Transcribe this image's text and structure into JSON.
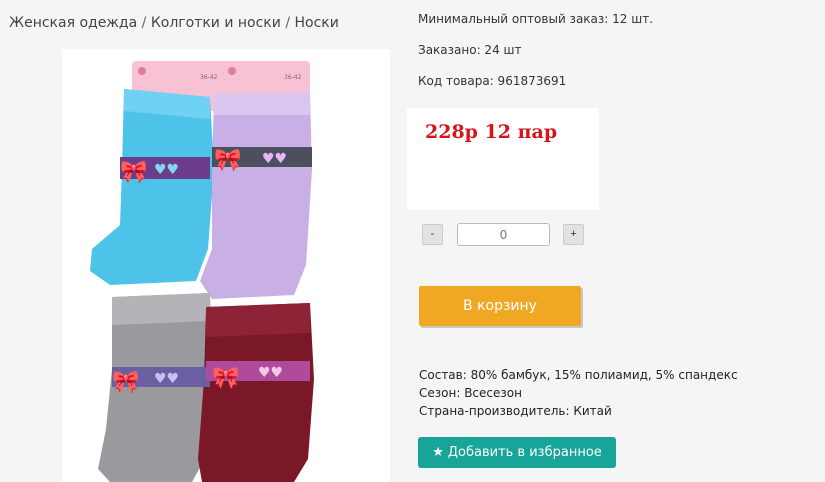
{
  "breadcrumb": {
    "items": [
      "Женская одежда",
      "Колготки и носки",
      "Носки"
    ],
    "separator": "/"
  },
  "product": {
    "image": {
      "description_icon": "socks-product-photo",
      "tag_text": "36-42"
    },
    "min_order": "Минимальный оптовый заказ: 12 шт.",
    "ordered": "Заказано: 24 шт",
    "code": "Код товара: 961873691",
    "price": "228р 12 пар",
    "quantity": {
      "minus_label": "-",
      "plus_label": "+",
      "value": "0"
    },
    "cart_label": "В корзину",
    "specs": {
      "composition": "Состав: 80% бамбук, 15% полиамид, 5% спандекс",
      "season": "Сезон: Всесезон",
      "country": "Страна-производитель: Китай"
    },
    "favorite_label": "Добавить в избранное"
  },
  "colors": {
    "price": "#d6141c",
    "cart_button": "#f0a824",
    "favorite_button": "#17a59a"
  }
}
